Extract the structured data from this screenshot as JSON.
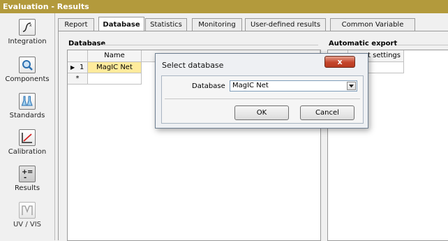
{
  "window": {
    "title": "Evaluation - Results"
  },
  "sidebar": {
    "items": [
      {
        "label": "Integration",
        "icon": "integration-icon"
      },
      {
        "label": "Components",
        "icon": "components-icon"
      },
      {
        "label": "Standards",
        "icon": "standards-icon"
      },
      {
        "label": "Calibration",
        "icon": "calibration-icon"
      },
      {
        "label": "Results",
        "icon": "results-icon"
      },
      {
        "label": "UV / VIS",
        "icon": "uv-vis-icon",
        "disabled": true
      }
    ]
  },
  "tabs": [
    {
      "label": "Report"
    },
    {
      "label": "Database",
      "active": true
    },
    {
      "label": "Statistics"
    },
    {
      "label": "Monitoring"
    },
    {
      "label": "User-defined results"
    },
    {
      "label": "Common Variable"
    }
  ],
  "database_group": {
    "title": "Database",
    "column_header": "Name database",
    "rows": [
      {
        "marker": "▶",
        "index": "1",
        "name": "MagIC Net"
      },
      {
        "marker": "*",
        "index": "",
        "name": ""
      }
    ]
  },
  "export_group": {
    "title": "Automatic export",
    "column_header": "ort settings"
  },
  "dialog": {
    "title": "Select database",
    "close": "x",
    "field_label": "Database",
    "field_value": "MagIC Net",
    "ok": "OK",
    "cancel": "Cancel"
  },
  "colors": {
    "title_bar": "#b39a3c",
    "selected_cell": "#ffeb9c",
    "close_button": "#c4452b"
  }
}
